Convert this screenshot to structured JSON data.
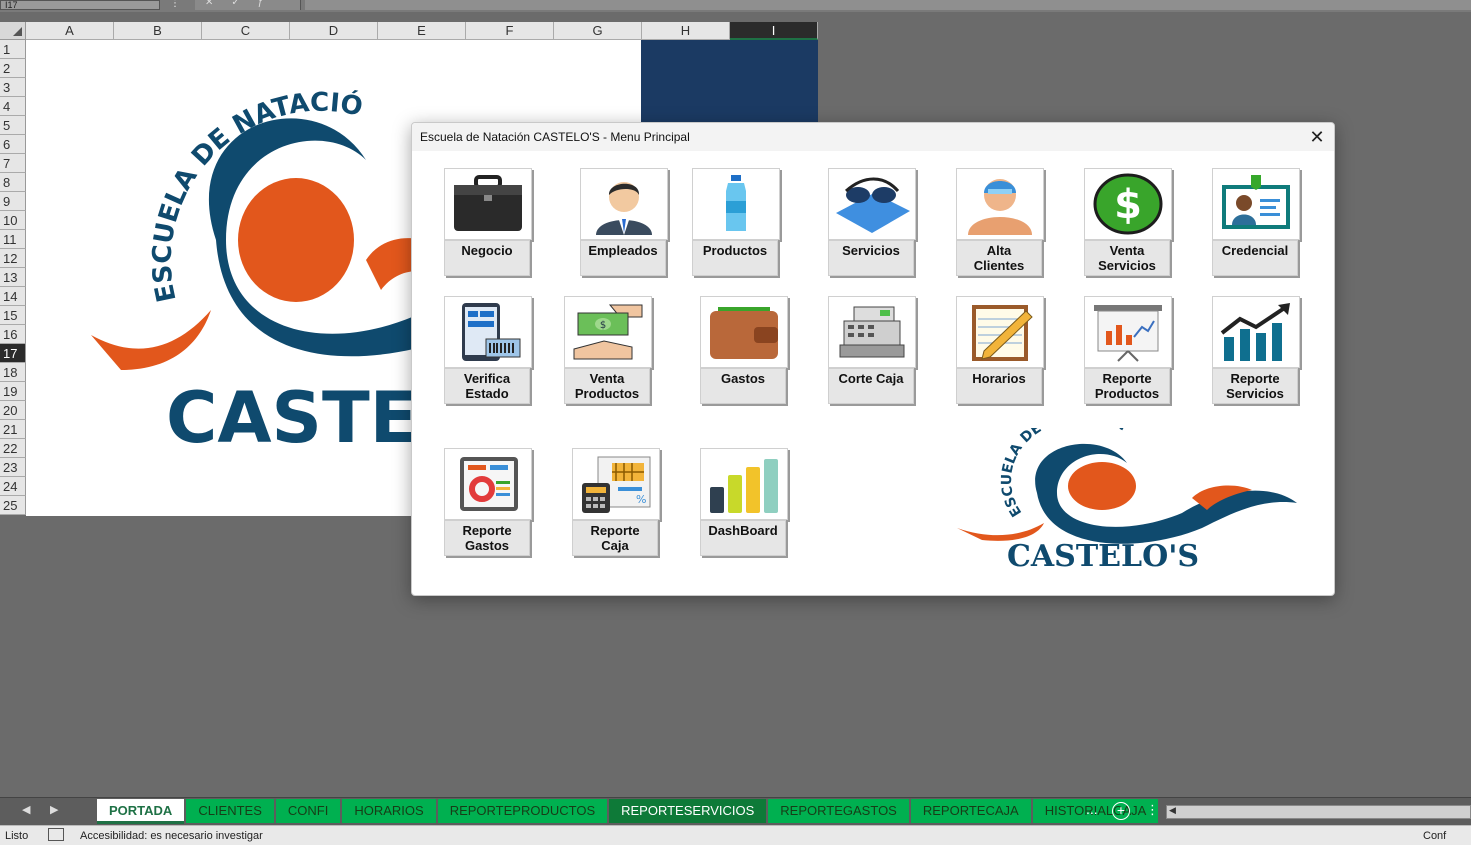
{
  "formula_bar": {
    "cell_ref": "I17"
  },
  "columns": [
    "A",
    "B",
    "C",
    "D",
    "E",
    "F",
    "G",
    "H",
    "I"
  ],
  "selected_column": "I",
  "rows": [
    "1",
    "2",
    "3",
    "4",
    "5",
    "6",
    "7",
    "8",
    "9",
    "10",
    "11",
    "12",
    "13",
    "14",
    "15",
    "16",
    "17",
    "18",
    "19",
    "20",
    "21",
    "22",
    "23",
    "24",
    "25"
  ],
  "selected_row": "17",
  "sheet_logo": {
    "arc_text": "ESCUELA DE NATACIÓN",
    "wordmark": "CASTEL"
  },
  "dialog": {
    "title": "Escuela de Natación CASTELO'S - Menu Principal",
    "close_glyph": "✕",
    "tiles": [
      {
        "id": "negocio",
        "label": "Negocio",
        "icon": "briefcase-icon"
      },
      {
        "id": "empleados",
        "label": "Empleados",
        "icon": "employee-icon"
      },
      {
        "id": "productos",
        "label": "Productos",
        "icon": "water-bottle-icon"
      },
      {
        "id": "servicios",
        "label": "Servicios",
        "icon": "swim-goggles-icon"
      },
      {
        "id": "alta-clientes",
        "label": "Alta\nClientes",
        "icon": "swimmer-icon"
      },
      {
        "id": "venta-servicios",
        "label": "Venta\nServicios",
        "icon": "dollar-icon"
      },
      {
        "id": "credencial",
        "label": "Credencial",
        "icon": "id-card-icon"
      },
      {
        "id": "verifica-estado",
        "label": "Verifica\nEstado",
        "icon": "barcode-check-icon"
      },
      {
        "id": "venta-productos",
        "label": "Venta\nProductos",
        "icon": "cash-hands-icon"
      },
      {
        "id": "gastos",
        "label": "Gastos",
        "icon": "wallet-icon"
      },
      {
        "id": "corte-caja",
        "label": "Corte Caja",
        "icon": "cash-register-icon"
      },
      {
        "id": "horarios",
        "label": "Horarios",
        "icon": "notepad-icon"
      },
      {
        "id": "reporte-productos",
        "label": "Reporte\nProductos",
        "icon": "presentation-chart-icon"
      },
      {
        "id": "reporte-servicios",
        "label": "Reporte\nServicios",
        "icon": "growth-chart-icon"
      },
      {
        "id": "reporte-gastos",
        "label": "Reporte\nGastos",
        "icon": "report-doc-icon"
      },
      {
        "id": "reporte-caja",
        "label": "Reporte\nCaja",
        "icon": "calculator-report-icon"
      },
      {
        "id": "dashboard",
        "label": "DashBoard",
        "icon": "bar-dashboard-icon"
      }
    ],
    "logo": {
      "arc_text": "ESCUELA DE NATACIÓN",
      "wordmark": "CASTELO'S"
    }
  },
  "sheet_tabs": [
    {
      "label": "PORTADA",
      "state": "active"
    },
    {
      "label": "CLIENTES",
      "state": "normal"
    },
    {
      "label": "CONFI",
      "state": "normal"
    },
    {
      "label": "HORARIOS",
      "state": "normal"
    },
    {
      "label": "REPORTEPRODUCTOS",
      "state": "normal"
    },
    {
      "label": "REPORTESERVICIOS",
      "state": "selected"
    },
    {
      "label": "REPORTEGASTOS",
      "state": "normal"
    },
    {
      "label": "REPORTECAJA",
      "state": "normal"
    },
    {
      "label": "HISTORIALCAJA",
      "state": "normal"
    }
  ],
  "tab_more": "...",
  "status": {
    "ready": "Listo",
    "accessibility": "Accesibilidad: es necesario investigar",
    "right": "Conf"
  },
  "colors": {
    "brand_navy": "#0f4a6e",
    "brand_orange": "#e2571c",
    "tab_green": "#00b050",
    "dark_blue_cell": "#1b3a63"
  }
}
